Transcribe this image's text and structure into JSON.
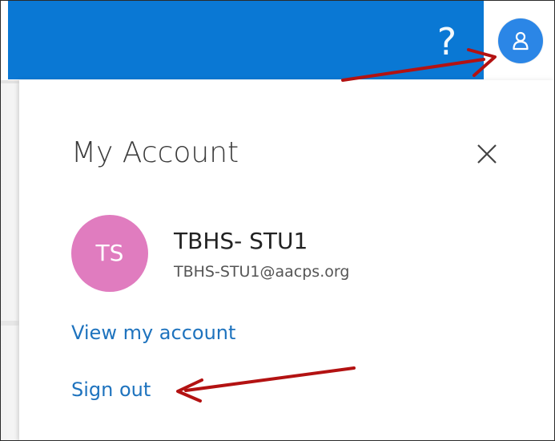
{
  "header": {
    "help_icon": "question-mark-icon",
    "help_glyph": "?",
    "profile_icon": "person-icon",
    "accent_color": "#0a78d4",
    "avatar_color": "#2b86e6"
  },
  "panel": {
    "title": "My Account",
    "close_icon": "close-icon",
    "user": {
      "initials": "TS",
      "name": "TBHS- STU1",
      "email": "TBHS-STU1@aacps.org",
      "avatar_color": "#e07cbf"
    },
    "links": {
      "view_account": "View my account",
      "sign_out": "Sign out"
    },
    "link_color": "#1e73be"
  },
  "annotations": {
    "arrow_color": "#b31212",
    "arrows": [
      {
        "points_to": "profile-avatar-button"
      },
      {
        "points_to": "sign-out-link"
      }
    ]
  }
}
